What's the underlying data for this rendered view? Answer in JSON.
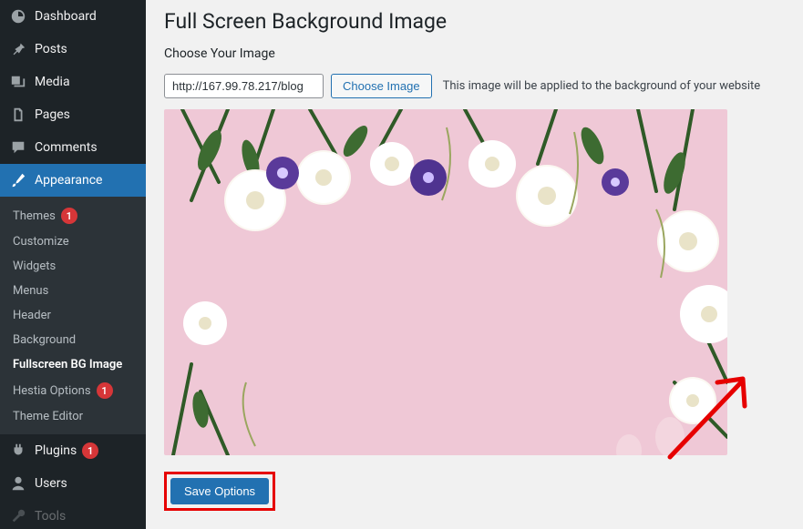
{
  "sidebar": {
    "items": [
      {
        "label": "Dashboard"
      },
      {
        "label": "Posts"
      },
      {
        "label": "Media"
      },
      {
        "label": "Pages"
      },
      {
        "label": "Comments"
      },
      {
        "label": "Appearance"
      },
      {
        "label": "Plugins",
        "badge": "1"
      },
      {
        "label": "Users"
      },
      {
        "label": "Tools"
      }
    ],
    "appearance_submenu": [
      {
        "label": "Themes",
        "badge": "1"
      },
      {
        "label": "Customize"
      },
      {
        "label": "Widgets"
      },
      {
        "label": "Menus"
      },
      {
        "label": "Header"
      },
      {
        "label": "Background"
      },
      {
        "label": "Fullscreen BG Image",
        "current": true
      },
      {
        "label": "Hestia Options",
        "badge": "1"
      },
      {
        "label": "Theme Editor"
      }
    ]
  },
  "page": {
    "title": "Full Screen Background Image",
    "subhead": "Choose Your Image",
    "image_url_value": "http://167.99.78.217/blog",
    "choose_image_label": "Choose Image",
    "helper_text": "This image will be applied to the background of your website",
    "save_label": "Save Options"
  }
}
